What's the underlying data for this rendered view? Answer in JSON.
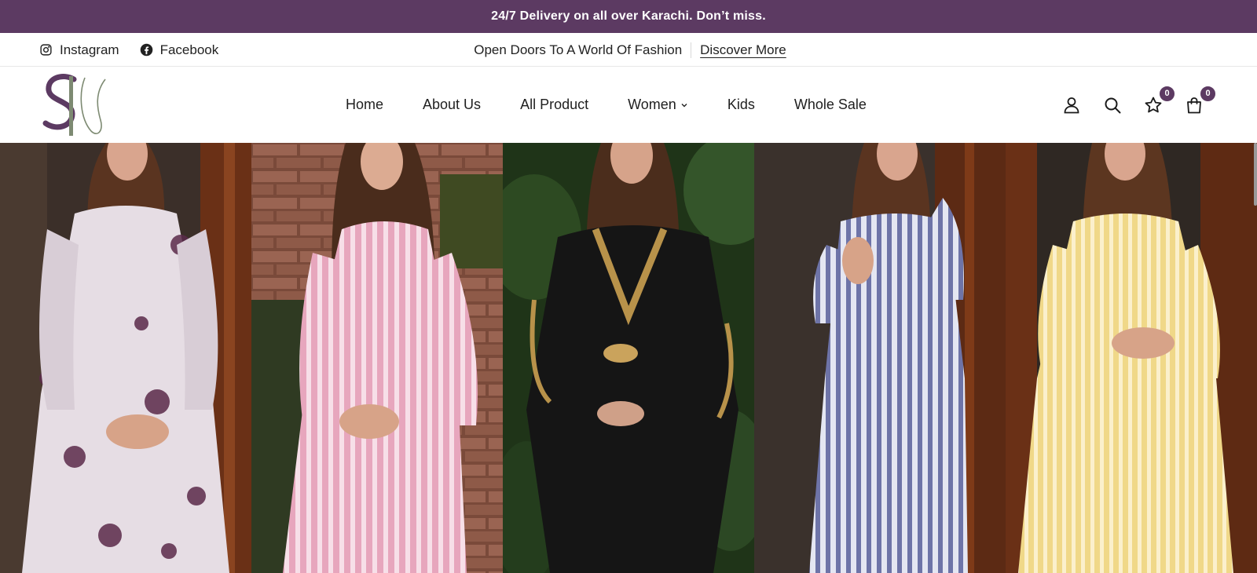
{
  "announcement": "24/7 Delivery on all over Karachi. Don’t miss.",
  "topbar": {
    "social": [
      {
        "label": "Instagram",
        "icon": "instagram-icon"
      },
      {
        "label": "Facebook",
        "icon": "facebook-icon"
      }
    ],
    "promo_text": "Open Doors To A World Of Fashion",
    "discover_label": "Discover More"
  },
  "nav": {
    "items": [
      {
        "label": "Home"
      },
      {
        "label": "About Us"
      },
      {
        "label": "All Product"
      },
      {
        "label": "Women",
        "dropdown": true
      },
      {
        "label": "Kids"
      },
      {
        "label": "Whole Sale"
      }
    ]
  },
  "header_icons": {
    "account": "user-icon",
    "search": "search-icon",
    "wishlist_count": "0",
    "cart_count": "0"
  },
  "hero": {
    "panels": [
      {
        "dress": "white-purple floral kurta",
        "color": "#e6dde4",
        "accent": "#5b2a4a"
      },
      {
        "dress": "pink striped kurta",
        "color": "#e7a6bd",
        "accent": "#f7dfe8"
      },
      {
        "dress": "black kaftan with gold trim",
        "color": "#161616",
        "accent": "#b8924a"
      },
      {
        "dress": "blue-white striped dress",
        "color": "#e4e6f2",
        "accent": "#6e74a8"
      },
      {
        "dress": "yellow striped dress",
        "color": "#f0d888",
        "accent": "#fbf0cc"
      }
    ]
  },
  "colors": {
    "brand": "#5c3a62",
    "logo_gray": "#7d8a72"
  }
}
